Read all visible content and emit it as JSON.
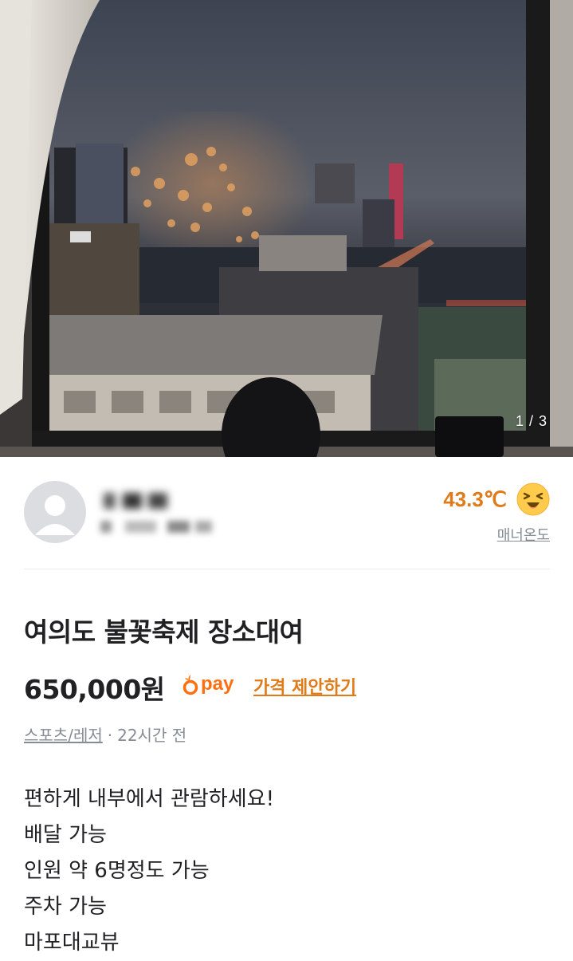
{
  "photo": {
    "counter": "1 / 3",
    "alt": "window view of fireworks over city"
  },
  "seller": {
    "name": "·· ·",
    "region": "·· ·· ··",
    "temperature": "43.3℃",
    "manner_label": "매너온도",
    "temperature_color": "#e07b1a"
  },
  "listing": {
    "title": "여의도 불꽃축제 장소대여",
    "price": "650,000원",
    "pay_label": "pay",
    "offer_link": "가격 제안하기",
    "category": "스포츠/레저",
    "separator": "·",
    "posted": "22시간 전",
    "description": [
      "편하게 내부에서 관람하세요!",
      "배달 가능",
      "인원 약 6명정도 가능",
      "주차 가능",
      "마포대교뷰"
    ]
  },
  "colors": {
    "accent": "#ff6f0f",
    "secondary_text": "#868b94",
    "divider": "#e9ecef"
  }
}
